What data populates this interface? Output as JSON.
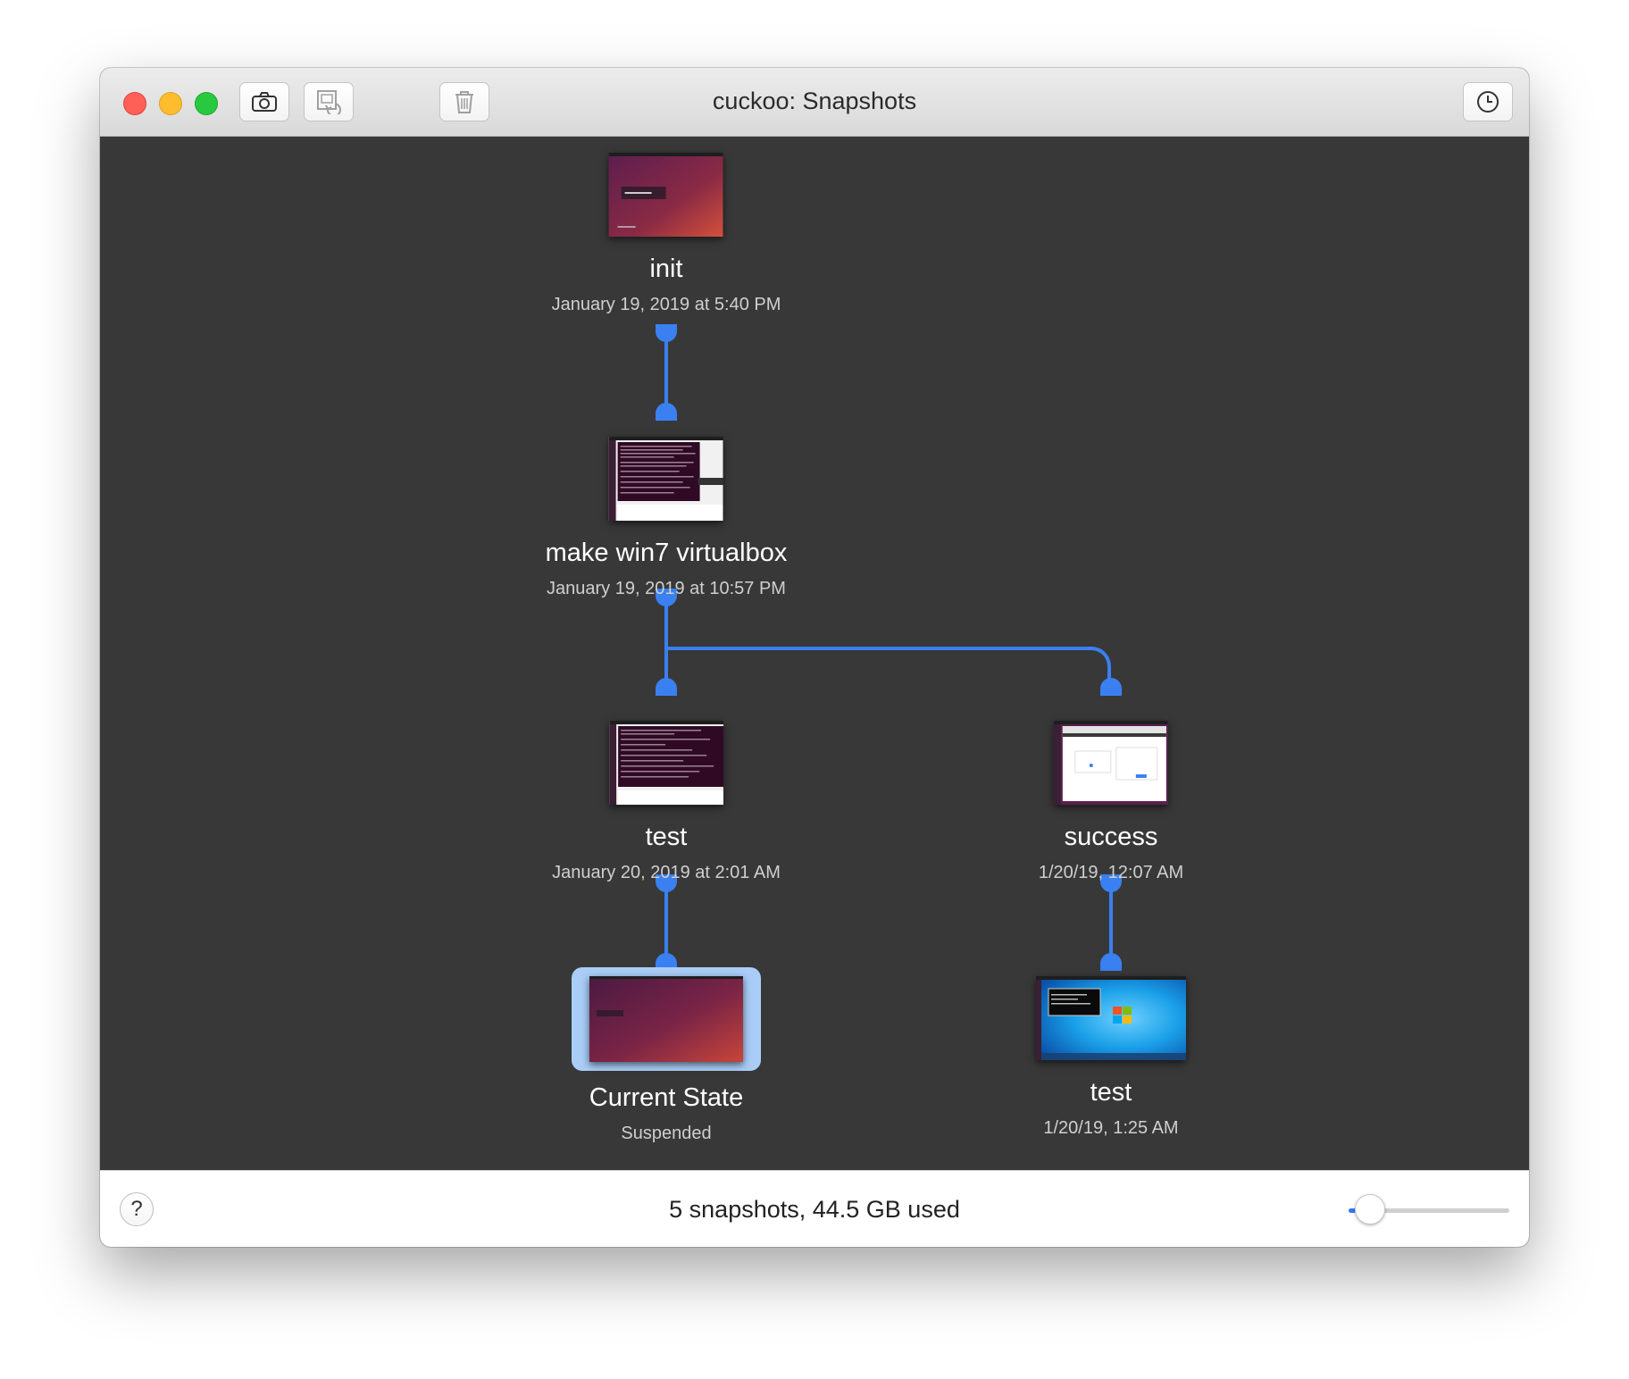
{
  "window": {
    "title": "cuckoo: Snapshots"
  },
  "toolbar": {
    "take_snapshot_icon": "camera-icon",
    "restore_icon": "restore-snapshot-icon",
    "delete_icon": "trash-icon",
    "history_icon": "clock-icon"
  },
  "snapshots": [
    {
      "name": "init",
      "date": "January 19, 2019 at 5:40 PM",
      "thumb": "ubuntu-login"
    },
    {
      "name": "make win7 virtualbox",
      "date": "January 19, 2019 at 10:57 PM",
      "thumb": "ubuntu-terminal"
    },
    {
      "name": "test",
      "date": "January 20, 2019 at 2:01 AM",
      "thumb": "ubuntu-terminal"
    },
    {
      "name": "success",
      "date": "1/20/19, 12:07 AM",
      "thumb": "ubuntu-browser"
    },
    {
      "name": "Current State",
      "date": "Suspended",
      "thumb": "ubuntu-desktop",
      "selected": true
    },
    {
      "name": "test",
      "date": "1/20/19, 1:25 AM",
      "thumb": "windows7-desktop"
    }
  ],
  "footer": {
    "status": "5 snapshots, 44.5 GB used",
    "help_label": "?",
    "zoom_level": 0.1
  },
  "colors": {
    "connector": "#3a80f0",
    "selection": "#a9cdf7",
    "canvas": "#383838"
  }
}
